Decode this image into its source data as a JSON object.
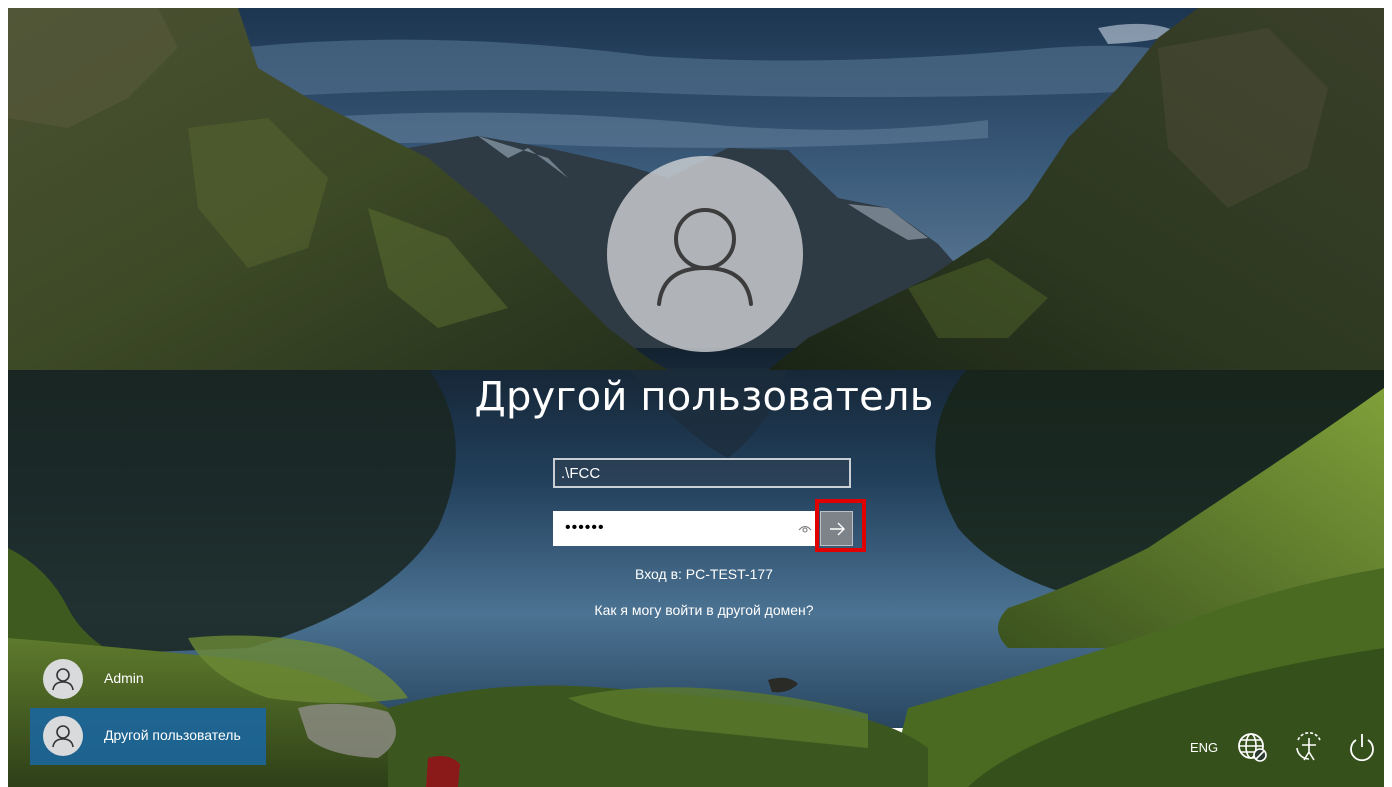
{
  "login": {
    "user_title": "Другой пользователь",
    "username_value": ".\\FCC",
    "password_mask": "••••••",
    "signin_to": "Вход в: PC-TEST-177",
    "other_domain_link": "Как я могу войти в другой домен?",
    "avatar_icon": "user-icon",
    "submit_icon": "arrow-right-icon",
    "reveal_icon": "eye-icon",
    "highlight_color": "#e00000"
  },
  "users": [
    {
      "label": "Admin",
      "icon": "user-icon",
      "selected": false
    },
    {
      "label": "Другой пользователь",
      "icon": "user-icon",
      "selected": true
    }
  ],
  "tray": {
    "language": "ENG",
    "network_icon": "network-disconnected-icon",
    "accessibility_icon": "ease-of-access-icon",
    "power_icon": "power-icon"
  },
  "colors": {
    "selected_tile": "#1a66a0",
    "submit_button": "#7d8389"
  }
}
